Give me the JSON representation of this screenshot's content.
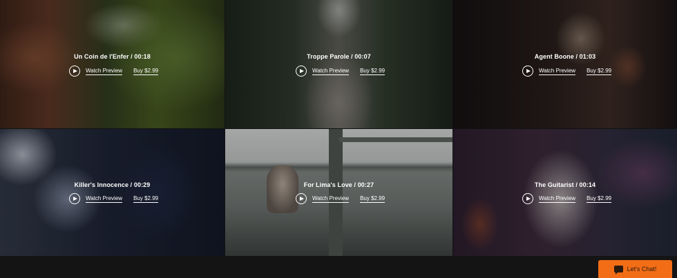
{
  "videos": [
    {
      "title": "Un Coin de l'Enfer / 00:18",
      "watch_label": "Watch Preview",
      "buy_label": "Buy $2.99"
    },
    {
      "title": "Troppe Parole / 00:07",
      "watch_label": "Watch Preview",
      "buy_label": "Buy $2.99"
    },
    {
      "title": "Agent Boone / 01:03",
      "watch_label": "Watch Preview",
      "buy_label": "Buy $2.99"
    },
    {
      "title": "Killer's Innocence / 00:29",
      "watch_label": "Watch Preview",
      "buy_label": "Buy $2.99"
    },
    {
      "title": "For Lima's Love / 00:27",
      "watch_label": "Watch Preview",
      "buy_label": "Buy $2.99"
    },
    {
      "title": "The Guitarist / 00:14",
      "watch_label": "Watch Preview",
      "buy_label": "Buy $2.99"
    }
  ],
  "chat": {
    "label": "Let's Chat!",
    "icon": "chat-bubble-icon",
    "color": "#f26d16"
  }
}
